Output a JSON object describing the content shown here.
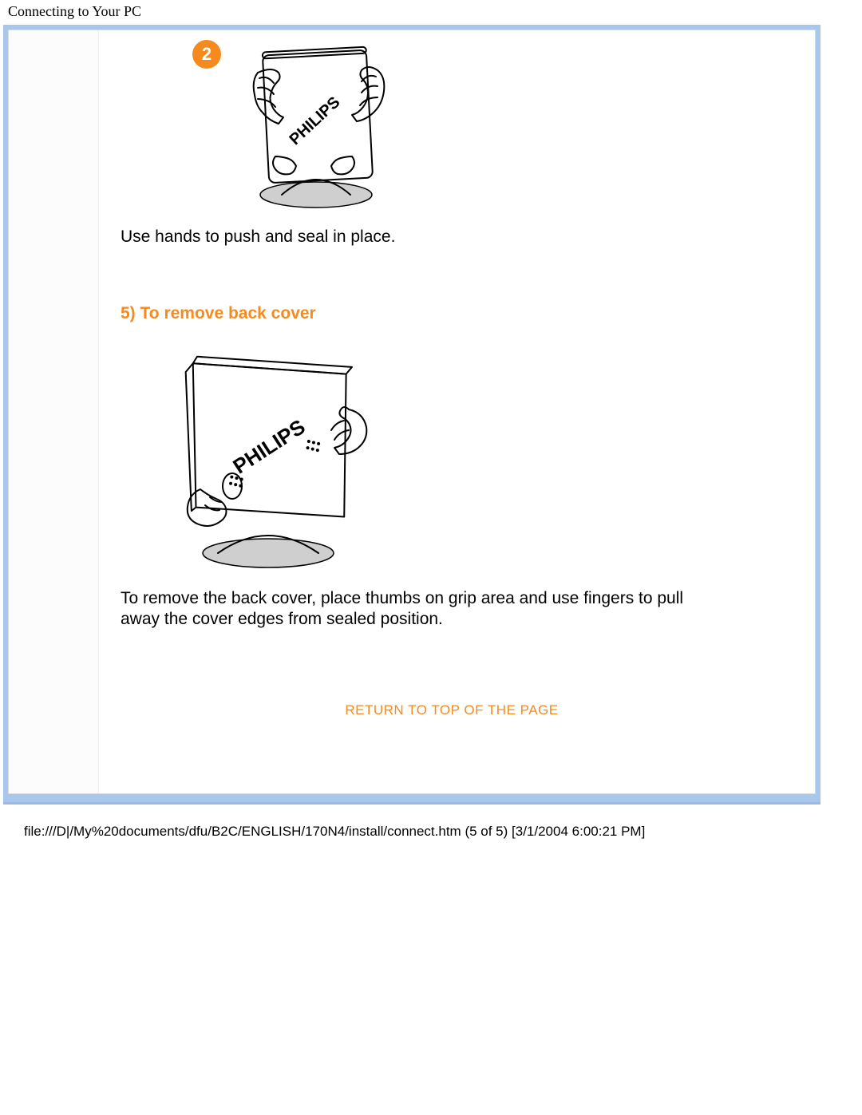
{
  "header": {
    "title": "Connecting to Your PC"
  },
  "step2": {
    "badge": "2",
    "caption": "Use hands to push and seal in place.",
    "brand": "PHILIPS"
  },
  "section5": {
    "heading": "5) To remove back cover",
    "brand": "PHILIPS",
    "description": "To remove the back cover, place thumbs on grip area and use fingers to pull away the cover edges from sealed position."
  },
  "return_link": "RETURN TO TOP OF THE PAGE",
  "footer": {
    "path": "file:///D|/My%20documents/dfu/B2C/ENGLISH/170N4/install/connect.htm (5 of 5) [3/1/2004 6:00:21 PM]"
  }
}
